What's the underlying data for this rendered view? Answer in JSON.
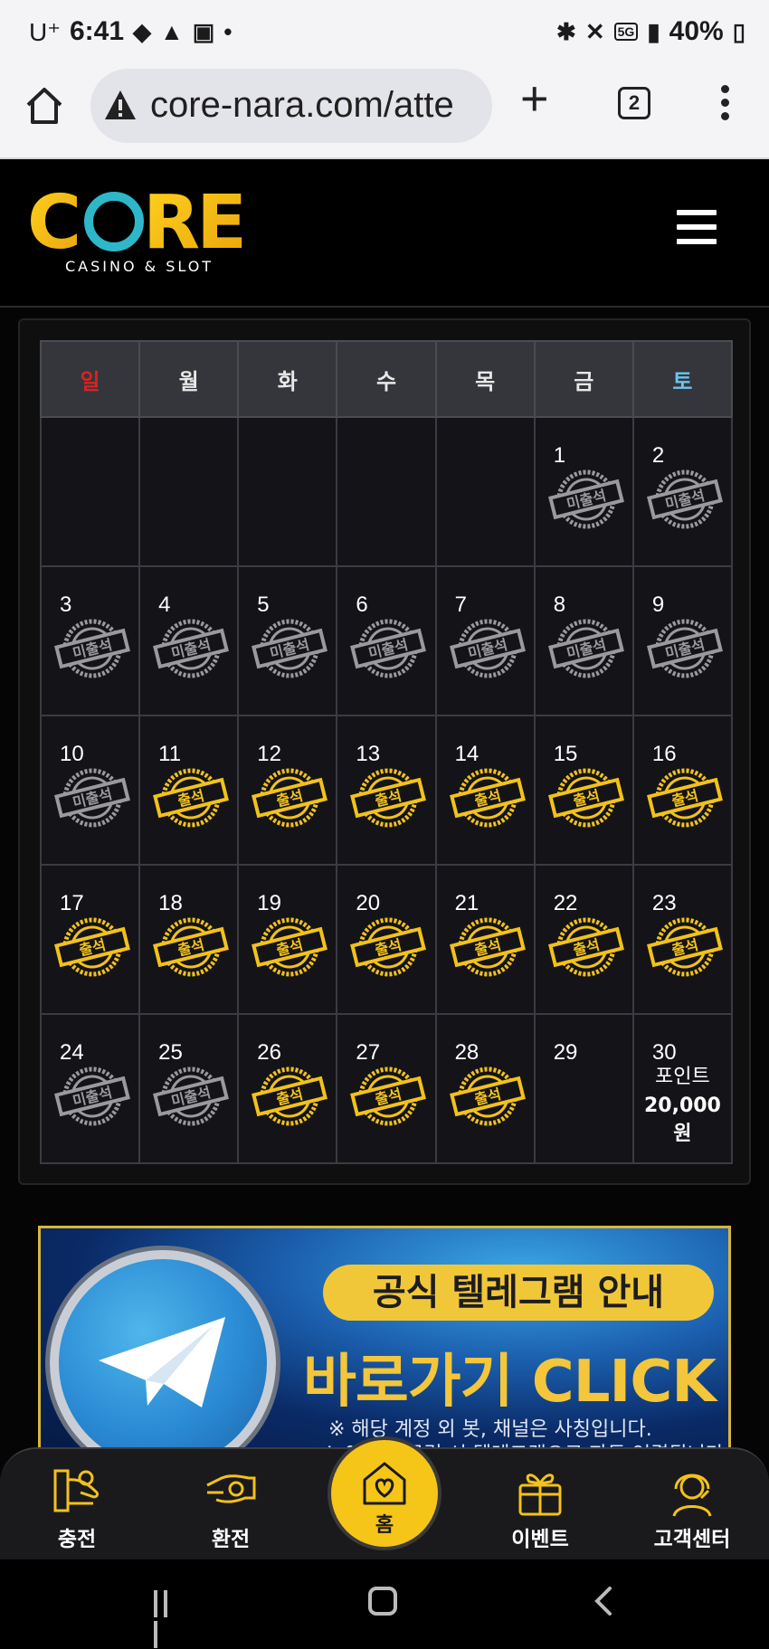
{
  "status_bar": {
    "carrier": "U⁺",
    "time": "6:41",
    "network": "5G",
    "battery": "40%"
  },
  "browser": {
    "url": "core-nara.com/atte",
    "tab_count": "2"
  },
  "site": {
    "logo_text": "CORE",
    "logo_subtitle": "CASINO & SLOT"
  },
  "calendar": {
    "weekdays": [
      "일",
      "월",
      "화",
      "수",
      "목",
      "금",
      "토"
    ],
    "stamp_attended": "출석",
    "stamp_missed": "미출석",
    "weeks": [
      [
        {
          "day": "",
          "status": "none"
        },
        {
          "day": "",
          "status": "none"
        },
        {
          "day": "",
          "status": "none"
        },
        {
          "day": "",
          "status": "none"
        },
        {
          "day": "",
          "status": "none"
        },
        {
          "day": "1",
          "status": "missed"
        },
        {
          "day": "2",
          "status": "missed"
        }
      ],
      [
        {
          "day": "3",
          "status": "missed"
        },
        {
          "day": "4",
          "status": "missed"
        },
        {
          "day": "5",
          "status": "missed"
        },
        {
          "day": "6",
          "status": "missed"
        },
        {
          "day": "7",
          "status": "missed"
        },
        {
          "day": "8",
          "status": "missed"
        },
        {
          "day": "9",
          "status": "missed"
        }
      ],
      [
        {
          "day": "10",
          "status": "missed"
        },
        {
          "day": "11",
          "status": "attended"
        },
        {
          "day": "12",
          "status": "attended"
        },
        {
          "day": "13",
          "status": "attended"
        },
        {
          "day": "14",
          "status": "attended"
        },
        {
          "day": "15",
          "status": "attended"
        },
        {
          "day": "16",
          "status": "attended"
        }
      ],
      [
        {
          "day": "17",
          "status": "attended"
        },
        {
          "day": "18",
          "status": "attended"
        },
        {
          "day": "19",
          "status": "attended"
        },
        {
          "day": "20",
          "status": "attended"
        },
        {
          "day": "21",
          "status": "attended"
        },
        {
          "day": "22",
          "status": "attended"
        },
        {
          "day": "23",
          "status": "attended"
        }
      ],
      [
        {
          "day": "24",
          "status": "missed"
        },
        {
          "day": "25",
          "status": "missed"
        },
        {
          "day": "26",
          "status": "attended"
        },
        {
          "day": "27",
          "status": "attended"
        },
        {
          "day": "28",
          "status": "attended"
        },
        {
          "day": "29",
          "status": "none"
        },
        {
          "day": "30",
          "status": "reward",
          "reward_label": "포인트",
          "reward_value": "20,000 원"
        }
      ]
    ]
  },
  "banner": {
    "title": "공식 텔레그램 안내",
    "cta": "바로가기 CLICK",
    "note1": "※ 해당 계정 외 봇, 채널은 사칭입니다.",
    "note2": "※ 이미지 클릭 시 텔레그램으로 자동 연결됩니다."
  },
  "bottom_nav": {
    "deposit": "충전",
    "withdraw": "환전",
    "home": "홈",
    "event": "이벤트",
    "support": "고객센터"
  },
  "colors": {
    "attended_stamp": "#f2c21b",
    "missed_stamp": "#9a9a9e",
    "sunday": "#e0201e",
    "saturday": "#6cc4f0",
    "accent": "#f5c518"
  }
}
